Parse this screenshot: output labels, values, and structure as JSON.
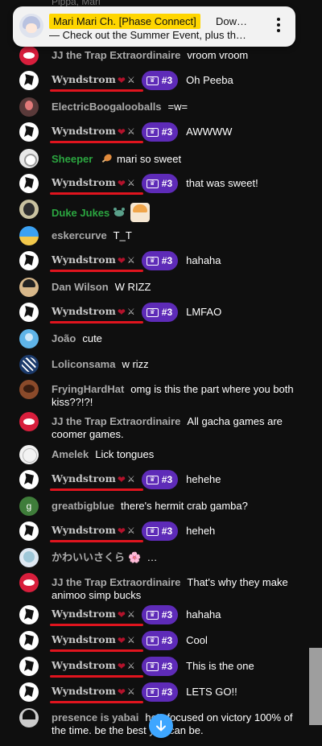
{
  "pinned": {
    "owner": "Mari Mari Ch. [Phase Connect]",
    "title": "Dow…",
    "subtitle": "— Check out the Summer Event, plus th…"
  },
  "top_cut_text": "Pippa, Mari",
  "wyndstrom": {
    "name": "Wyndstrom",
    "heart": "❤",
    "swords": "⚔",
    "badge": "#3"
  },
  "messages": [
    {
      "author": "JJ the Trap Extraordinaire",
      "text": "vroom vroom",
      "avatar": "red"
    },
    {
      "wynd": true,
      "text": "Oh Peeba"
    },
    {
      "author": "ElectricBoogalooballs",
      "text": "=w=",
      "avatar": "electric"
    },
    {
      "wynd": true,
      "text": "AWWWW"
    },
    {
      "author": "Sheeper",
      "text": "mari so sweet",
      "avatar": "sheep",
      "green": true
    },
    {
      "wynd": true,
      "text": "that was sweet!"
    },
    {
      "author": "Duke Jukes",
      "text": "",
      "avatar": "duke",
      "green": true
    },
    {
      "author": "eskercurve",
      "text": "T_T",
      "avatar": "esker"
    },
    {
      "wynd": true,
      "text": "hahaha"
    },
    {
      "author": "Dan Wilson",
      "text": "W RIZZ",
      "avatar": "dan"
    },
    {
      "wynd": true,
      "text": "LMFAO"
    },
    {
      "author": "João",
      "text": "cute",
      "avatar": "joao"
    },
    {
      "author": "Loliconsama",
      "text": "w rizz",
      "avatar": "loli"
    },
    {
      "author": "FryingHardHat",
      "text": "omg is this the part where you both kiss??!?!",
      "avatar": "frying"
    },
    {
      "author": "JJ the Trap Extraordinaire",
      "text": "All gacha games are coomer games.",
      "avatar": "red"
    },
    {
      "author": "Amelek",
      "text": "Lick tongues",
      "avatar": "amelek"
    },
    {
      "wynd": true,
      "text": "hehehe"
    },
    {
      "author": "greatbigblue",
      "text": "there's hermit crab gamba?",
      "avatar": "g",
      "initial": "g"
    },
    {
      "wynd": true,
      "text": "heheh"
    },
    {
      "author": "かわいいさくら",
      "text": "…",
      "avatar": "kawaii",
      "flower": "🌸"
    },
    {
      "author": "JJ the Trap Extraordinaire",
      "text": "That's why they make animoo simp bucks",
      "avatar": "red"
    },
    {
      "wynd": true,
      "text": "hahaha"
    },
    {
      "wynd": true,
      "text": "Cool"
    },
    {
      "wynd": true,
      "text": "This is the one"
    },
    {
      "wynd": true,
      "text": "LETS GO!!"
    },
    {
      "author": "presence is yabai",
      "text": "he's focused on victory 100% of the time. be the best you can be.",
      "avatar": "presence"
    }
  ]
}
